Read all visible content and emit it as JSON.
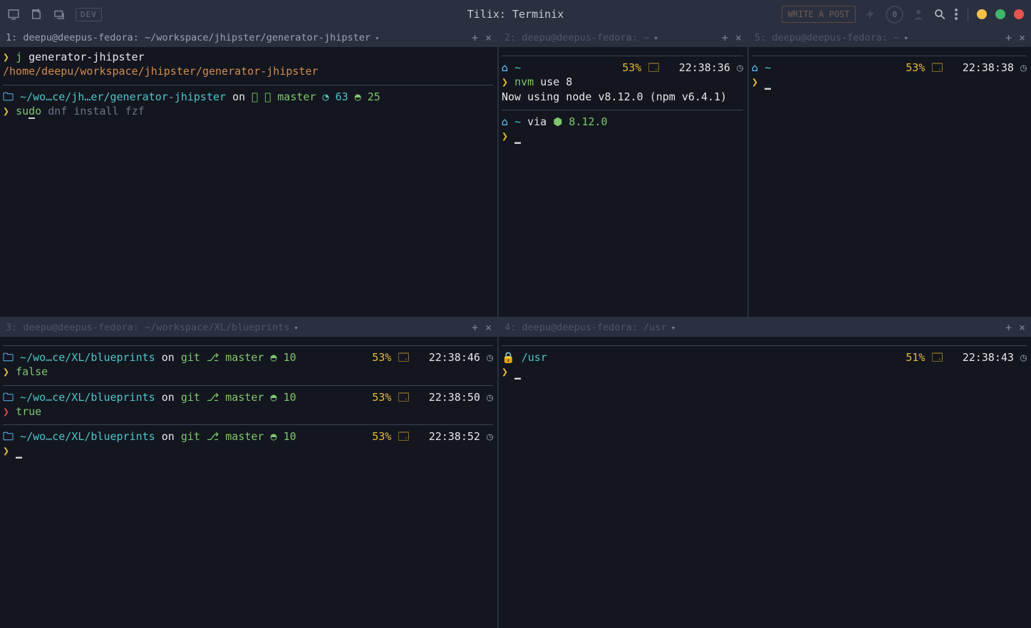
{
  "window": {
    "title": "Tilix: Terminix",
    "traffic": [
      "min",
      "max",
      "close"
    ],
    "badge": "DEV",
    "write_post": "WRITE A POST"
  },
  "tabs": {
    "p1": "1: deepu@deepus-fedora: ~/workspace/jhipster/generator-jhipster",
    "p2": "2: deepu@deepus-fedora: ~",
    "p5": "5: deepu@deepus-fedora: ~",
    "p3": "3: deepu@deepus-fedora: ~/workspace/XL/blueprints",
    "p4": "4: deepu@deepus-fedora: /usr"
  },
  "pane1": {
    "cmd1_j": "j",
    "cmd1_arg": "generator-jhipster",
    "cwd_out": "/home/deepu/workspace/jhipster/generator-jhipster",
    "path": "~/wo…ce/jh…er/generator-jhipster",
    "on": "on",
    "branch": "master",
    "clock": "63",
    "mem": "25",
    "cmd2_sudo": "sudo",
    "cmd2_rest": "dnf install fzf",
    "cmd2_underline_char": "d",
    "cmd2_after_under": "o"
  },
  "pane2": {
    "battery": "53%",
    "time1": "22:38:36",
    "nvm_cmd": "nvm",
    "nvm_args": "use 8",
    "nvm_out": "Now using node v8.12.0 (npm v6.4.1)",
    "via": "via",
    "node_ver": "8.12.0",
    "tilde": "~"
  },
  "pane5": {
    "battery": "53%",
    "time": "22:38:38",
    "tilde": "~"
  },
  "pane3": {
    "path": "~/wo…ce/XL/blueprints",
    "on": "on",
    "branch": "master",
    "stash": "10",
    "batt": "53%",
    "t1": "22:38:46",
    "t2": "22:38:50",
    "t3": "22:38:52",
    "cmd1": "false",
    "cmd2": "true"
  },
  "pane4": {
    "path": "/usr",
    "batt": "51%",
    "time": "22:38:43"
  }
}
